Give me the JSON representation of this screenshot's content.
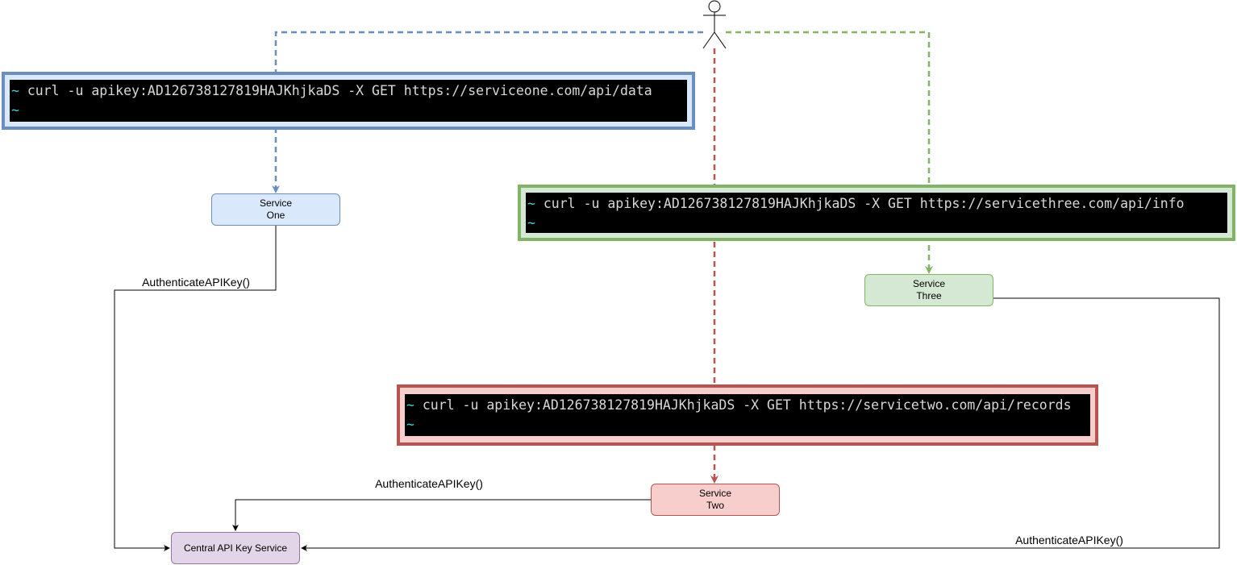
{
  "colors": {
    "blue": "#6c8ebf",
    "blue_fill": "#dae8fc",
    "green": "#82b366",
    "green_fill": "#d5e8d4",
    "red": "#b85450",
    "red_fill": "#f8cecc",
    "purple": "#9673a6",
    "purple_fill": "#e1d5e7"
  },
  "actor": {
    "icon": "stick-figure-icon"
  },
  "terminals": [
    {
      "prompt": "~",
      "command": "curl -u apikey:AD126738127819HAJKhjkaDS -X GET https://serviceone.com/api/data",
      "prompt2": "~"
    },
    {
      "prompt": "~",
      "command": "curl -u apikey:AD126738127819HAJKhjkaDS -X GET https://servicethree.com/api/info",
      "prompt2": "~"
    },
    {
      "prompt": "~",
      "command": "curl -u apikey:AD126738127819HAJKhjkaDS -X GET https://servicetwo.com/api/records",
      "prompt2": "~"
    }
  ],
  "services": {
    "one": [
      "Service",
      "One"
    ],
    "two": [
      "Service",
      "Two"
    ],
    "three": [
      "Service",
      "Three"
    ],
    "central": "Central API Key Service"
  },
  "edge_labels": {
    "one": "AuthenticateAPIKey()",
    "two": "AuthenticateAPIKey()",
    "three": "AuthenticateAPIKey()"
  }
}
